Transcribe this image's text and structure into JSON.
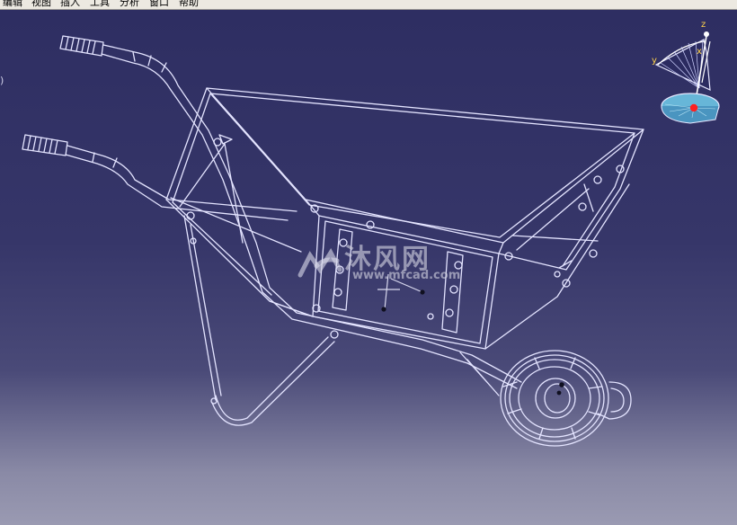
{
  "menubar": {
    "items": [
      {
        "label": "编辑"
      },
      {
        "label": "视图"
      },
      {
        "label": "插入"
      },
      {
        "label": "工具"
      },
      {
        "label": "分析"
      },
      {
        "label": "窗口"
      },
      {
        "label": "帮助"
      }
    ]
  },
  "viewport": {
    "model_name": "wheelbarrow-wireframe",
    "background_top": "#2e2e62",
    "background_bottom": "#9a9ab2",
    "wire_color": "#e4e4ff",
    "edge_mark": ")"
  },
  "compass": {
    "label_x": "x",
    "label_y": "y",
    "label_z": "z",
    "label_color": "#ffd24a",
    "base_dot_color": "#ff2020"
  },
  "watermark": {
    "chinese": "沐风网",
    "url": "www.mfcad.com"
  }
}
